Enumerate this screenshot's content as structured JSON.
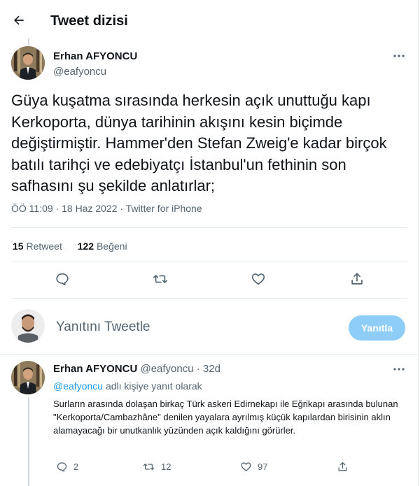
{
  "header": {
    "title": "Tweet dizisi"
  },
  "tweet": {
    "author_name": "Erhan AFYONCU",
    "author_handle": "@eafyoncu",
    "text": "Güya kuşatma sırasında herkesin açık unuttuğu kapı Kerkoporta, dünya tarihinin akışını kesin biçimde değiştirmiştir. Hammer'den Stefan Zweig'e kadar birçok batılı tarihçi ve edebiyatçı İstanbul'un fethinin son safhasını şu şekilde anlatırlar;",
    "meta": "ÖÖ 11:09 · 18 Haz 2022 · Twitter for iPhone",
    "retweet_count": "15",
    "retweet_label": "Retweet",
    "like_count": "122",
    "like_label": "Beğeni"
  },
  "reply_box": {
    "placeholder": "Yanıtını Tweetle",
    "button_label": "Yanıtla"
  },
  "reply_tweet": {
    "author_name": "Erhan AFYONCU",
    "author_handle": "@eafyoncu",
    "separator": "·",
    "age": "32d",
    "reply_mention": "@eafyoncu",
    "reply_suffix": "adlı kişiye yanıt olarak",
    "text": "Surların arasında dolaşan birkaç Türk askeri Edirnekapı ile Eğrikapı arasında bulunan \"Kerkoporta/Cambazhâne\" denilen yayalara ayrılmış küçük kapılardan birisinin aklın alamayacağı bir unutkanlık yüzünden açık kaldığını görürler.",
    "reply_count": "2",
    "retweet_count": "12",
    "like_count": "97"
  },
  "colors": {
    "accent": "#1d9bf0",
    "reply_button": "#8ecdf8",
    "muted": "#536471",
    "text": "#0f1419"
  },
  "icons": [
    "back-arrow-icon",
    "more-icon",
    "reply-icon",
    "retweet-icon",
    "like-icon",
    "share-icon"
  ]
}
